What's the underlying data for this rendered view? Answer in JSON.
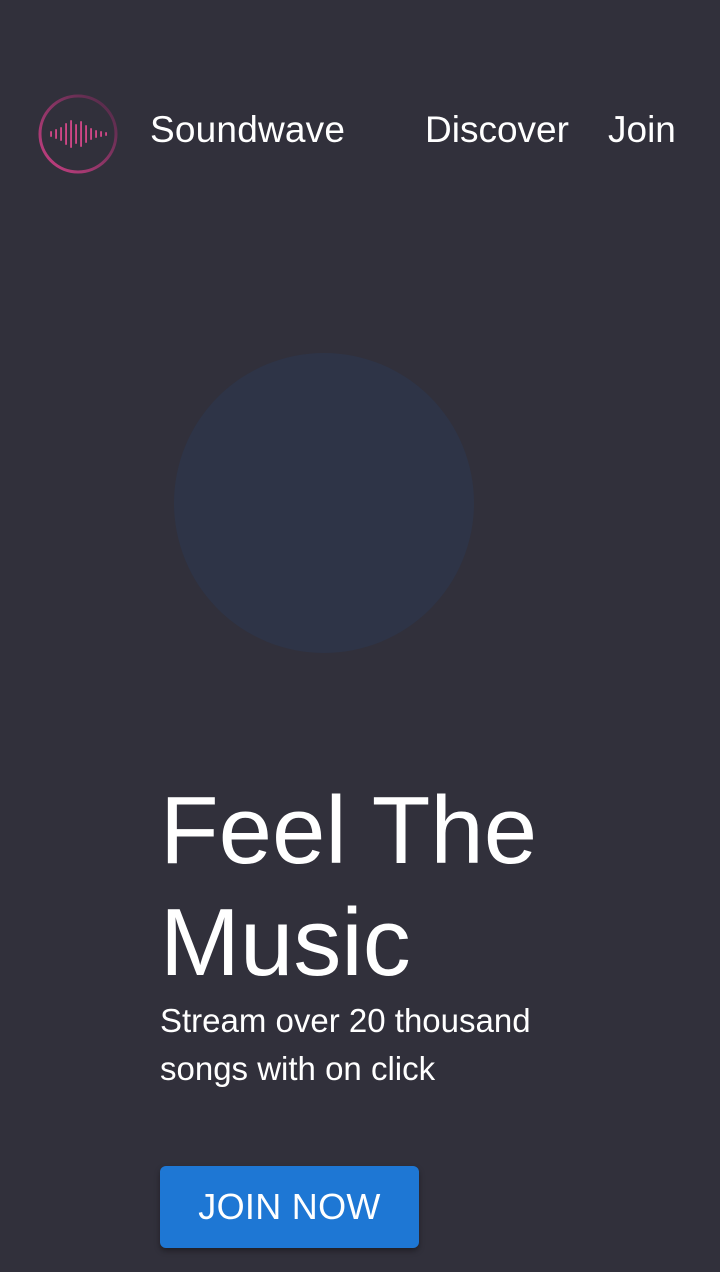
{
  "header": {
    "brand": "Soundwave",
    "nav": {
      "discover": "Discover",
      "join": "Join"
    }
  },
  "hero": {
    "title": "Feel The Music",
    "subtitle": "Stream over 20 thousand songs with on click",
    "cta_label": "JOIN NOW"
  },
  "icons": {
    "logo": "soundwave-logo-icon"
  },
  "colors": {
    "background": "#31303b",
    "hero_circle": "#2e3447",
    "accent_button": "#1e77d4",
    "logo_gradient_start": "#c13d7d",
    "logo_gradient_end": "#6f2e55",
    "text": "#ffffff"
  }
}
